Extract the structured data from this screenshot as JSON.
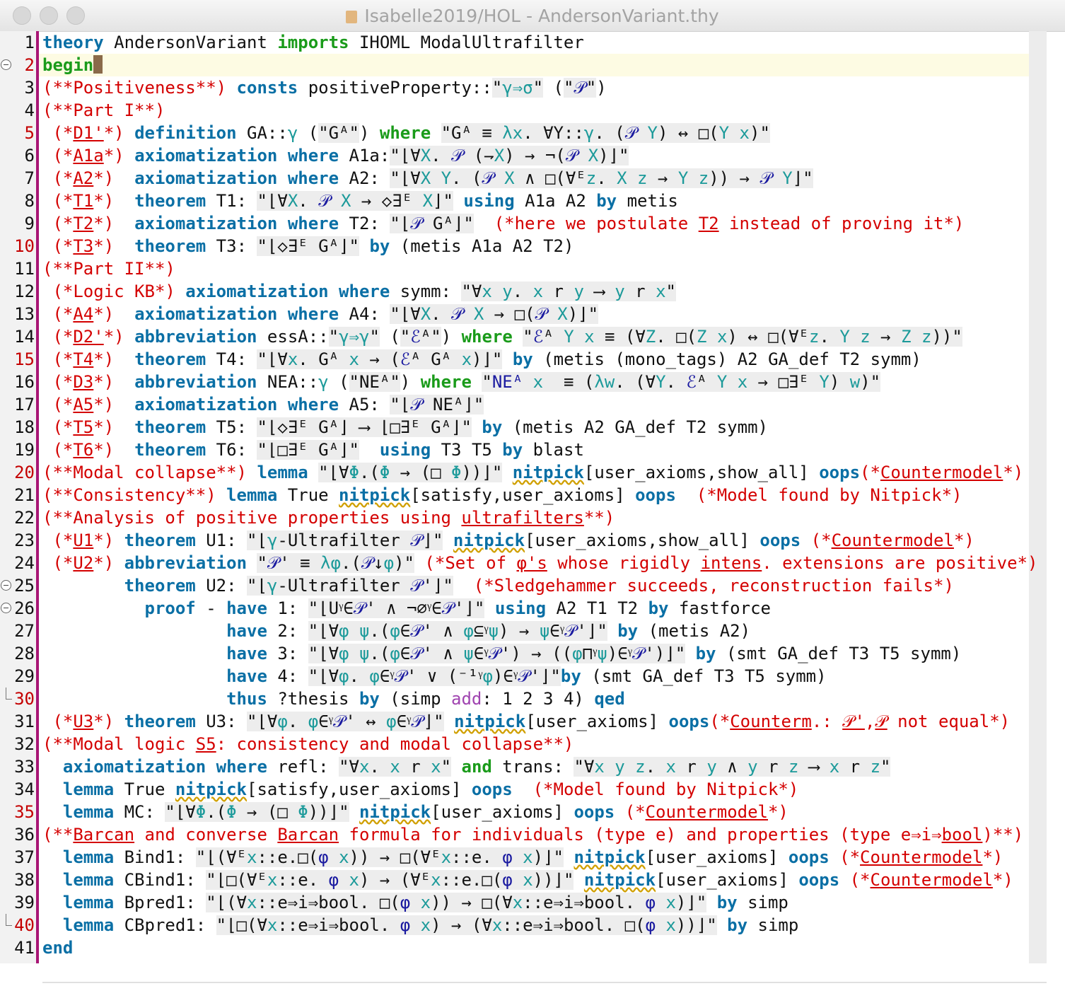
{
  "window": {
    "title": "Isabelle2019/HOL - AndersonVariant.thy"
  },
  "editor": {
    "current_line": 2,
    "lines": [
      {
        "n": "1",
        "t": "theory AndersonVariant imports IHOML ModalUltrafilter"
      },
      {
        "n": "2",
        "t": "begin"
      },
      {
        "n": "3",
        "t": "(**Positiveness**) consts positiveProperty::\"γ⇒σ\" (\"𝒫\")"
      },
      {
        "n": "4",
        "t": "(**Part I**)"
      },
      {
        "n": "5",
        "t": " (*D1'*) definition GA::γ (\"Gᴬ\") where \"Gᴬ ≡ λx. ∀Y::γ. (𝒫 Y) ↔ □(Y x)\""
      },
      {
        "n": "6",
        "t": " (*A1a*) axiomatization where A1a:\"⌊∀X. 𝒫 (⇁X) → ¬(𝒫 X)⌋\""
      },
      {
        "n": "7",
        "t": " (*A2*)  axiomatization where A2: \"⌊∀X Y. (𝒫 X ∧ □(∀ᴱz. X z → Y z)) → 𝒫 Y⌋\""
      },
      {
        "n": "8",
        "t": " (*T1*)  theorem T1: \"⌊∀X. 𝒫 X → ◇∃ᴱ X⌋\" using A1a A2 by metis"
      },
      {
        "n": "9",
        "t": " (*T2*)  axiomatization where T2: \"⌊𝒫 Gᴬ⌋\"  (*here we postulate T2 instead of proving it*)"
      },
      {
        "n": "10",
        "t": " (*T3*)  theorem T3: \"⌊◇∃ᴱ Gᴬ⌋\" by (metis A1a A2 T2)"
      },
      {
        "n": "11",
        "t": "(**Part II**)"
      },
      {
        "n": "12",
        "t": " (*Logic KB*) axiomatization where symm: \"∀x y. x r y ⟶ y r x\""
      },
      {
        "n": "13",
        "t": " (*A4*)  axiomatization where A4: \"⌊∀X. 𝒫 X → □(𝒫 X)⌋\""
      },
      {
        "n": "14",
        "t": " (*D2'*) abbreviation essA::\"γ⇒γ\" (\"ℰᴬ\") where \"ℰᴬ Y x ≡ (∀Z. □(Z x) ↔ □(∀ᴱz. Y z → Z z))\""
      },
      {
        "n": "15",
        "t": " (*T4*)  theorem T4: \"⌊∀x. Gᴬ x → (ℰᴬ Gᴬ x)⌋\" by (metis (mono_tags) A2 GA_def T2 symm)"
      },
      {
        "n": "16",
        "t": " (*D3*)  abbreviation NEA::γ (\"NEᴬ\") where \"NEᴬ x  ≡ (λw. (∀Y. ℰᴬ Y x → □∃ᴱ Y) w)\""
      },
      {
        "n": "17",
        "t": " (*A5*)  axiomatization where A5: \"⌊𝒫 NEᴬ⌋\""
      },
      {
        "n": "18",
        "t": " (*T5*)  theorem T5: \"⌊◇∃ᴱ Gᴬ⌋ ⟶ ⌊□∃ᴱ Gᴬ⌋\" by (metis A2 GA_def T2 symm)"
      },
      {
        "n": "19",
        "t": " (*T6*)  theorem T6: \"⌊□∃ᴱ Gᴬ⌋\"  using T3 T5 by blast"
      },
      {
        "n": "20",
        "t": "(**Modal collapse**) lemma \"⌊∀Φ.(Φ → (□ Φ))⌋\" nitpick[user_axioms,show_all] oops(*Countermodel*)"
      },
      {
        "n": "21",
        "t": "(**Consistency**) lemma True nitpick[satisfy,user_axioms] oops  (*Model found by Nitpick*)"
      },
      {
        "n": "22",
        "t": "(**Analysis of positive properties using ultrafilters**)"
      },
      {
        "n": "23",
        "t": " (*U1*) theorem U1: \"⌊γ-Ultrafilter 𝒫⌋\" nitpick[user_axioms,show_all] oops (*Countermodel*)"
      },
      {
        "n": "24",
        "t": " (*U2*) abbreviation \"𝒫' ≡ λφ.(𝒫↓φ)\" (*Set of φ's whose rigidly intens. extensions are positive*)"
      },
      {
        "n": "25",
        "t": "        theorem U2: \"⌊γ-Ultrafilter 𝒫'⌋\"  (*Sledgehammer succeeds, reconstruction fails*)"
      },
      {
        "n": "26",
        "t": "          proof - have 1: \"⌊Uᵞ∈𝒫' ∧ ¬∅ᵞ∈𝒫'⌋\" using A2 T1 T2 by fastforce"
      },
      {
        "n": "27",
        "t": "                  have 2: \"⌊∀φ ψ.(φ∈𝒫' ∧ φ⊆ᵞψ) → ψ∈ᵞ𝒫'⌋\" by (metis A2)"
      },
      {
        "n": "28",
        "t": "                  have 3: \"⌊∀φ ψ.(φ∈𝒫' ∧ ψ∈ᵞ𝒫') → ((φ⊓ᵞψ)∈ᵞ𝒫')⌋\" by (smt GA_def T3 T5 symm)"
      },
      {
        "n": "29",
        "t": "                  have 4: \"⌊∀φ. φ∈ᵞ𝒫' ∨ (⁻¹ᵞφ)∈ᵞ𝒫'⌋\"by (smt GA_def T3 T5 symm)"
      },
      {
        "n": "30",
        "t": "                  thus ?thesis by (simp add: 1 2 3 4) qed"
      },
      {
        "n": "31",
        "t": " (*U3*) theorem U3: \"⌊∀φ. φ∈ᵞ𝒫' ↔ φ∈ᵞ𝒫⌋\" nitpick[user_axioms] oops(*Counterm.: 𝒫',𝒫 not equal*)"
      },
      {
        "n": "32",
        "t": "(**Modal logic S5: consistency and modal collapse**)"
      },
      {
        "n": "33",
        "t": "  axiomatization where refl: \"∀x. x r x\" and trans: \"∀x y z. x r y ∧ y r z ⟶ x r z\""
      },
      {
        "n": "34",
        "t": "  lemma True nitpick[satisfy,user_axioms] oops  (*Model found by Nitpick*)"
      },
      {
        "n": "35",
        "t": "  lemma MC: \"⌊∀Φ.(Φ → (□ Φ))⌋\" nitpick[user_axioms] oops (*Countermodel*)"
      },
      {
        "n": "36",
        "t": "(**Barcan and converse Barcan formula for individuals (type e) and properties (type e⇒i⇒bool)**)"
      },
      {
        "n": "37",
        "t": "  lemma Bind1: \"⌊(∀ᴱx::e.□(φ x)) → □(∀ᴱx::e. φ x)⌋\" nitpick[user_axioms] oops (*Countermodel*)"
      },
      {
        "n": "38",
        "t": "  lemma CBind1: \"⌊□(∀ᴱx::e. φ x) → (∀ᴱx::e.□(φ x))⌋\" nitpick[user_axioms] oops (*Countermodel*)"
      },
      {
        "n": "39",
        "t": "  lemma Bpred1: \"⌊(∀x::e⇒i⇒bool. □(φ x)) → □(∀x::e⇒i⇒bool. φ x)⌋\" by simp"
      },
      {
        "n": "40",
        "t": "  lemma CBpred1: \"⌊□(∀x::e⇒i⇒bool. φ x) → (∀x::e⇒i⇒bool. □(φ x))⌋\" by simp"
      },
      {
        "n": "41",
        "t": "end"
      }
    ]
  }
}
